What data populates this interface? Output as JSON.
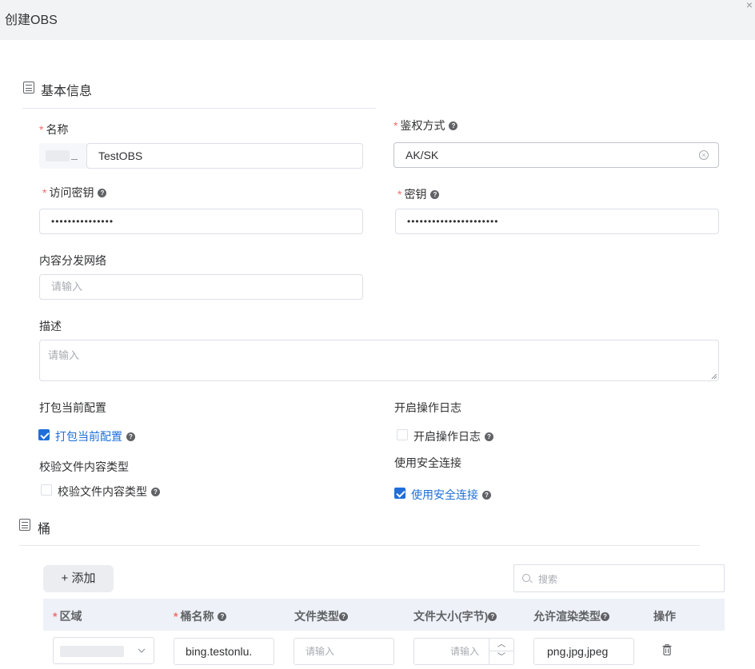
{
  "dialog": {
    "title": "创建OBS",
    "close_glyph": "×"
  },
  "sections": {
    "basic": "基本信息",
    "bucket": "桶"
  },
  "form": {
    "name": {
      "label": "名称",
      "value": "TestOBS"
    },
    "auth": {
      "label": "鉴权方式",
      "value": "AK/SK"
    },
    "access_key": {
      "label": "访问密钥",
      "value": "•••••••••••••••"
    },
    "secret_key": {
      "label": "密钥",
      "value": "••••••••••••••••••••••"
    },
    "cdn": {
      "label": "内容分发网络",
      "placeholder": "请输入"
    },
    "description": {
      "label": "描述",
      "placeholder": "请输入"
    },
    "pack": {
      "label": "打包当前配置",
      "checkbox_label": "打包当前配置",
      "checked": true
    },
    "log": {
      "label": "开启操作日志",
      "checkbox_label": "开启操作日志",
      "checked": false
    },
    "verify": {
      "label": "校验文件内容类型",
      "checkbox_label": "校验文件内容类型",
      "checked": false
    },
    "secure": {
      "label": "使用安全连接",
      "checkbox_label": "使用安全连接",
      "checked": true
    }
  },
  "table": {
    "add_button": "+ 添加",
    "search_placeholder": "搜索",
    "columns": {
      "region": "区域",
      "bucket_name": "桶名称",
      "file_type": "文件类型",
      "file_size": "文件大小(字节)",
      "render_types": "允许渲染类型",
      "actions": "操作"
    },
    "rows": [
      {
        "bucket_name": "bing.testonlu.",
        "file_type_placeholder": "请输入",
        "file_size_placeholder": "请输入",
        "render_types": "png,jpg,jpeg"
      }
    ]
  },
  "icons": {
    "help": "question-circle-icon",
    "clear": "circle-close-icon",
    "section": "list-icon",
    "search": "search-icon",
    "delete": "trash-icon"
  },
  "colors": {
    "accent": "#1e6fd9",
    "required": "#f56c6c",
    "header_bg": "#eef1f7"
  }
}
